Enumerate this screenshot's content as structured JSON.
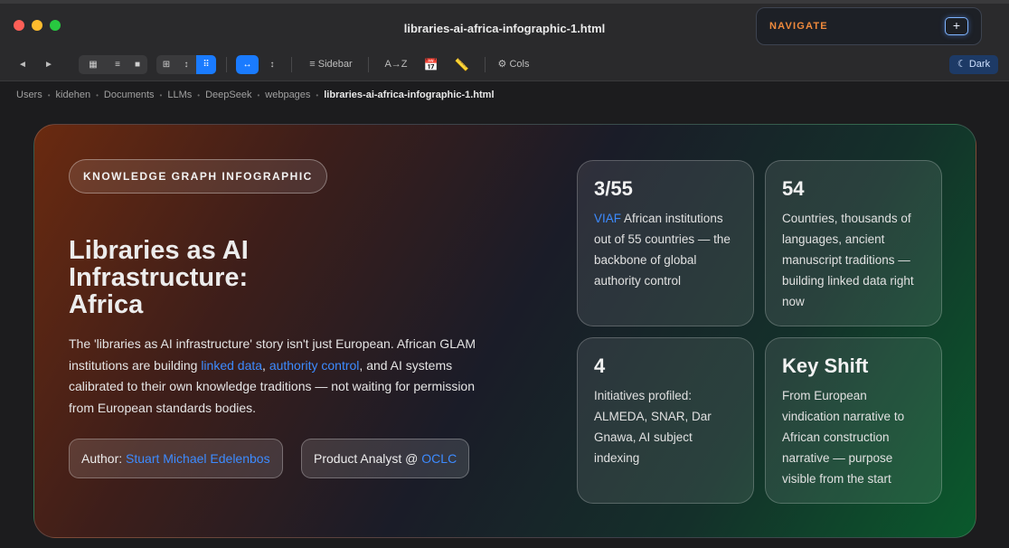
{
  "window": {
    "title": "libraries-ai-africa-infographic-1.html"
  },
  "navigate": {
    "label": "NAVIGATE",
    "plus": "+"
  },
  "toolbar": {
    "back": "◄",
    "forward": "►",
    "view_icons": "▦",
    "view_list": "≡",
    "view_cover": "■",
    "grid": "⊞",
    "sort_vertical": "↕",
    "grid_dense": "⠿",
    "fit_width": "↔",
    "fit_height": "↕",
    "sidebar": "≡ Sidebar",
    "sort_az": "A→Z",
    "calendar": "📅",
    "ruler": "📏",
    "cols": "⚙ Cols",
    "dark": "☾ Dark"
  },
  "breadcrumb": [
    "Users",
    "kidehen",
    "Documents",
    "LLMs",
    "DeepSeek",
    "webpages",
    "libraries-ai-africa-infographic-1.html"
  ],
  "hero": {
    "badge": "KNOWLEDGE GRAPH INFOGRAPHIC",
    "title_line1": "Libraries as AI",
    "title_line2": "Infrastructure:",
    "title_line3": "Africa",
    "lede_part1": "The 'libraries as AI infrastructure' story isn't just European. African GLAM institutions are building ",
    "lede_link1": "linked data",
    "lede_part2": ", ",
    "lede_link2": "authority control",
    "lede_part3": ", and AI systems calibrated to their own knowledge traditions — not waiting for permission from European standards bodies.",
    "author_label": "Author: ",
    "author_name": "Stuart Michael Edelenbos",
    "role_label": "Product Analyst @ ",
    "role_org": "OCLC"
  },
  "stats": [
    {
      "value": "3/55",
      "link": "VIAF",
      "text": " African institutions out of 55 countries — the backbone of global authority control"
    },
    {
      "value": "54",
      "text": "Countries, thousands of languages, ancient manuscript traditions — building linked data right now"
    },
    {
      "value": "4",
      "text": "Initiatives profiled: ALMEDA, SNAR, Dar Gnawa, AI subject indexing"
    },
    {
      "value": "Key Shift",
      "text": "From European vindication narrative to African construction narrative — purpose visible from the start"
    }
  ]
}
